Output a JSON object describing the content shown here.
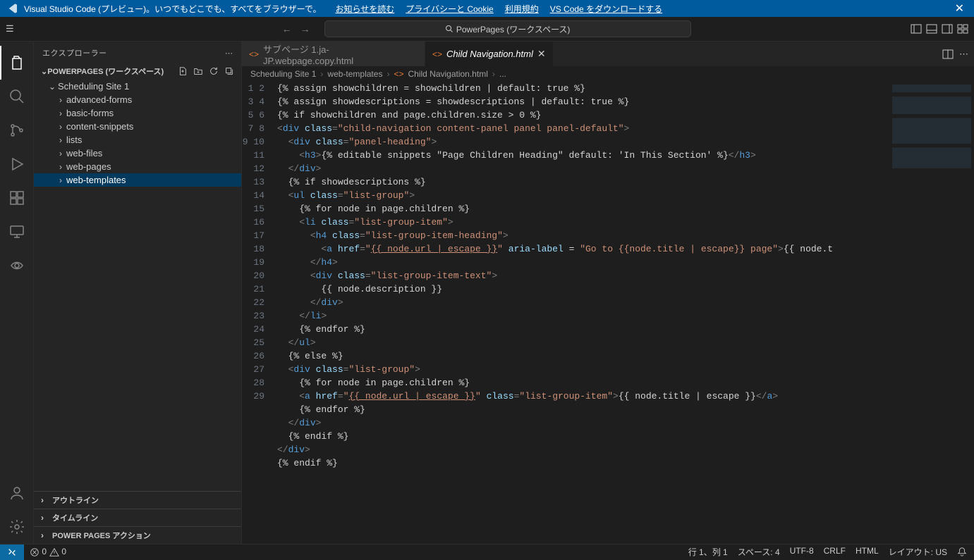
{
  "banner": {
    "text": "Visual Studio Code (プレビュー)。いつでもどこでも、すべてをブラウザーで。",
    "links": [
      "お知らせを読む",
      "プライバシーと Cookie",
      "利用規約",
      "VS Code をダウンロードする"
    ]
  },
  "titlebar": {
    "search": "PowerPages (ワークスペース)"
  },
  "sidebar": {
    "title": "エクスプローラー",
    "workspace": "POWERPAGES (ワークスペース)",
    "tree": [
      {
        "label": "Scheduling Site 1",
        "depth": 0,
        "expanded": true
      },
      {
        "label": "advanced-forms",
        "depth": 1,
        "expanded": false
      },
      {
        "label": "basic-forms",
        "depth": 1,
        "expanded": false
      },
      {
        "label": "content-snippets",
        "depth": 1,
        "expanded": false
      },
      {
        "label": "lists",
        "depth": 1,
        "expanded": false
      },
      {
        "label": "web-files",
        "depth": 1,
        "expanded": false
      },
      {
        "label": "web-pages",
        "depth": 1,
        "expanded": false
      },
      {
        "label": "web-templates",
        "depth": 1,
        "expanded": false,
        "selected": true
      }
    ],
    "panels": [
      "アウトライン",
      "タイムライン",
      "POWER PAGES アクション"
    ]
  },
  "tabs": [
    {
      "label": "サブページ 1.ja-JP.webpage.copy.html",
      "active": false
    },
    {
      "label": "Child Navigation.html",
      "active": true
    }
  ],
  "breadcrumbs": [
    "Scheduling Site 1",
    "web-templates",
    "Child Navigation.html",
    "..."
  ],
  "code": {
    "lines": [
      [
        {
          "t": "liq",
          "v": "{% assign showchildren = showchildren | default: true %}"
        }
      ],
      [
        {
          "t": "liq",
          "v": "{% assign showdescriptions = showdescriptions | default: true %}"
        }
      ],
      [
        {
          "t": "liq",
          "v": "{% if showchildren and page.children.size > 0 %}"
        }
      ],
      [
        {
          "t": "pun",
          "v": "<"
        },
        {
          "t": "tag",
          "v": "div"
        },
        {
          "t": "liq",
          "v": " "
        },
        {
          "t": "attr",
          "v": "class"
        },
        {
          "t": "pun",
          "v": "="
        },
        {
          "t": "str",
          "v": "\"child-navigation content-panel panel panel-default\""
        },
        {
          "t": "pun",
          "v": ">"
        }
      ],
      [
        {
          "t": "liq",
          "v": "  "
        },
        {
          "t": "pun",
          "v": "<"
        },
        {
          "t": "tag",
          "v": "div"
        },
        {
          "t": "liq",
          "v": " "
        },
        {
          "t": "attr",
          "v": "class"
        },
        {
          "t": "pun",
          "v": "="
        },
        {
          "t": "str",
          "v": "\"panel-heading\""
        },
        {
          "t": "pun",
          "v": ">"
        }
      ],
      [
        {
          "t": "liq",
          "v": "    "
        },
        {
          "t": "pun",
          "v": "<"
        },
        {
          "t": "tag",
          "v": "h3"
        },
        {
          "t": "pun",
          "v": ">"
        },
        {
          "t": "liq",
          "v": "{% editable snippets \"Page Children Heading\" default: 'In This Section' %}"
        },
        {
          "t": "pun",
          "v": "</"
        },
        {
          "t": "tag",
          "v": "h3"
        },
        {
          "t": "pun",
          "v": ">"
        }
      ],
      [
        {
          "t": "liq",
          "v": "  "
        },
        {
          "t": "pun",
          "v": "</"
        },
        {
          "t": "tag",
          "v": "div"
        },
        {
          "t": "pun",
          "v": ">"
        }
      ],
      [
        {
          "t": "liq",
          "v": "  {% if showdescriptions %}"
        }
      ],
      [
        {
          "t": "liq",
          "v": "  "
        },
        {
          "t": "pun",
          "v": "<"
        },
        {
          "t": "tag",
          "v": "ul"
        },
        {
          "t": "liq",
          "v": " "
        },
        {
          "t": "attr",
          "v": "class"
        },
        {
          "t": "pun",
          "v": "="
        },
        {
          "t": "str",
          "v": "\"list-group\""
        },
        {
          "t": "pun",
          "v": ">"
        }
      ],
      [
        {
          "t": "liq",
          "v": "    {% for node in page.children %}"
        }
      ],
      [
        {
          "t": "liq",
          "v": "    "
        },
        {
          "t": "pun",
          "v": "<"
        },
        {
          "t": "tag",
          "v": "li"
        },
        {
          "t": "liq",
          "v": " "
        },
        {
          "t": "attr",
          "v": "class"
        },
        {
          "t": "pun",
          "v": "="
        },
        {
          "t": "str",
          "v": "\"list-group-item\""
        },
        {
          "t": "pun",
          "v": ">"
        }
      ],
      [
        {
          "t": "liq",
          "v": "      "
        },
        {
          "t": "pun",
          "v": "<"
        },
        {
          "t": "tag",
          "v": "h4"
        },
        {
          "t": "liq",
          "v": " "
        },
        {
          "t": "attr",
          "v": "class"
        },
        {
          "t": "pun",
          "v": "="
        },
        {
          "t": "str",
          "v": "\"list-group-item-heading\""
        },
        {
          "t": "pun",
          "v": ">"
        }
      ],
      [
        {
          "t": "liq",
          "v": "        "
        },
        {
          "t": "pun",
          "v": "<"
        },
        {
          "t": "tag",
          "v": "a"
        },
        {
          "t": "liq",
          "v": " "
        },
        {
          "t": "attr",
          "v": "href"
        },
        {
          "t": "pun",
          "v": "="
        },
        {
          "t": "str",
          "v": "\""
        },
        {
          "t": "url",
          "v": "{{ node.url | escape }}"
        },
        {
          "t": "str",
          "v": "\""
        },
        {
          "t": "liq",
          "v": " "
        },
        {
          "t": "attr",
          "v": "aria-label"
        },
        {
          "t": "liq",
          "v": " = "
        },
        {
          "t": "str",
          "v": "\"Go to {{node.title | escape}} page\""
        },
        {
          "t": "pun",
          "v": ">"
        },
        {
          "t": "liq",
          "v": "{{ node.t"
        }
      ],
      [
        {
          "t": "liq",
          "v": "      "
        },
        {
          "t": "pun",
          "v": "</"
        },
        {
          "t": "tag",
          "v": "h4"
        },
        {
          "t": "pun",
          "v": ">"
        }
      ],
      [
        {
          "t": "liq",
          "v": "      "
        },
        {
          "t": "pun",
          "v": "<"
        },
        {
          "t": "tag",
          "v": "div"
        },
        {
          "t": "liq",
          "v": " "
        },
        {
          "t": "attr",
          "v": "class"
        },
        {
          "t": "pun",
          "v": "="
        },
        {
          "t": "str",
          "v": "\"list-group-item-text\""
        },
        {
          "t": "pun",
          "v": ">"
        }
      ],
      [
        {
          "t": "liq",
          "v": "        {{ node.description }}"
        }
      ],
      [
        {
          "t": "liq",
          "v": "      "
        },
        {
          "t": "pun",
          "v": "</"
        },
        {
          "t": "tag",
          "v": "div"
        },
        {
          "t": "pun",
          "v": ">"
        }
      ],
      [
        {
          "t": "liq",
          "v": "    "
        },
        {
          "t": "pun",
          "v": "</"
        },
        {
          "t": "tag",
          "v": "li"
        },
        {
          "t": "pun",
          "v": ">"
        }
      ],
      [
        {
          "t": "liq",
          "v": "    {% endfor %}"
        }
      ],
      [
        {
          "t": "liq",
          "v": "  "
        },
        {
          "t": "pun",
          "v": "</"
        },
        {
          "t": "tag",
          "v": "ul"
        },
        {
          "t": "pun",
          "v": ">"
        }
      ],
      [
        {
          "t": "liq",
          "v": "  {% else %}"
        }
      ],
      [
        {
          "t": "liq",
          "v": "  "
        },
        {
          "t": "pun",
          "v": "<"
        },
        {
          "t": "tag",
          "v": "div"
        },
        {
          "t": "liq",
          "v": " "
        },
        {
          "t": "attr",
          "v": "class"
        },
        {
          "t": "pun",
          "v": "="
        },
        {
          "t": "str",
          "v": "\"list-group\""
        },
        {
          "t": "pun",
          "v": ">"
        }
      ],
      [
        {
          "t": "liq",
          "v": "    {% for node in page.children %}"
        }
      ],
      [
        {
          "t": "liq",
          "v": "    "
        },
        {
          "t": "pun",
          "v": "<"
        },
        {
          "t": "tag",
          "v": "a"
        },
        {
          "t": "liq",
          "v": " "
        },
        {
          "t": "attr",
          "v": "href"
        },
        {
          "t": "pun",
          "v": "="
        },
        {
          "t": "str",
          "v": "\""
        },
        {
          "t": "url",
          "v": "{{ node.url | escape }}"
        },
        {
          "t": "str",
          "v": "\""
        },
        {
          "t": "liq",
          "v": " "
        },
        {
          "t": "attr",
          "v": "class"
        },
        {
          "t": "pun",
          "v": "="
        },
        {
          "t": "str",
          "v": "\"list-group-item\""
        },
        {
          "t": "pun",
          "v": ">"
        },
        {
          "t": "liq",
          "v": "{{ node.title | escape }}"
        },
        {
          "t": "pun",
          "v": "</"
        },
        {
          "t": "tag",
          "v": "a"
        },
        {
          "t": "pun",
          "v": ">"
        }
      ],
      [
        {
          "t": "liq",
          "v": "    {% endfor %}"
        }
      ],
      [
        {
          "t": "liq",
          "v": "  "
        },
        {
          "t": "pun",
          "v": "</"
        },
        {
          "t": "tag",
          "v": "div"
        },
        {
          "t": "pun",
          "v": ">"
        }
      ],
      [
        {
          "t": "liq",
          "v": "  {% endif %}"
        }
      ],
      [
        {
          "t": "pun",
          "v": "</"
        },
        {
          "t": "tag",
          "v": "div"
        },
        {
          "t": "pun",
          "v": ">"
        }
      ],
      [
        {
          "t": "liq",
          "v": "{% endif %}"
        }
      ]
    ]
  },
  "status": {
    "errors": "0",
    "warnings": "0",
    "right": [
      "行 1、列 1",
      "スペース: 4",
      "UTF-8",
      "CRLF",
      "HTML",
      "レイアウト: US"
    ]
  }
}
